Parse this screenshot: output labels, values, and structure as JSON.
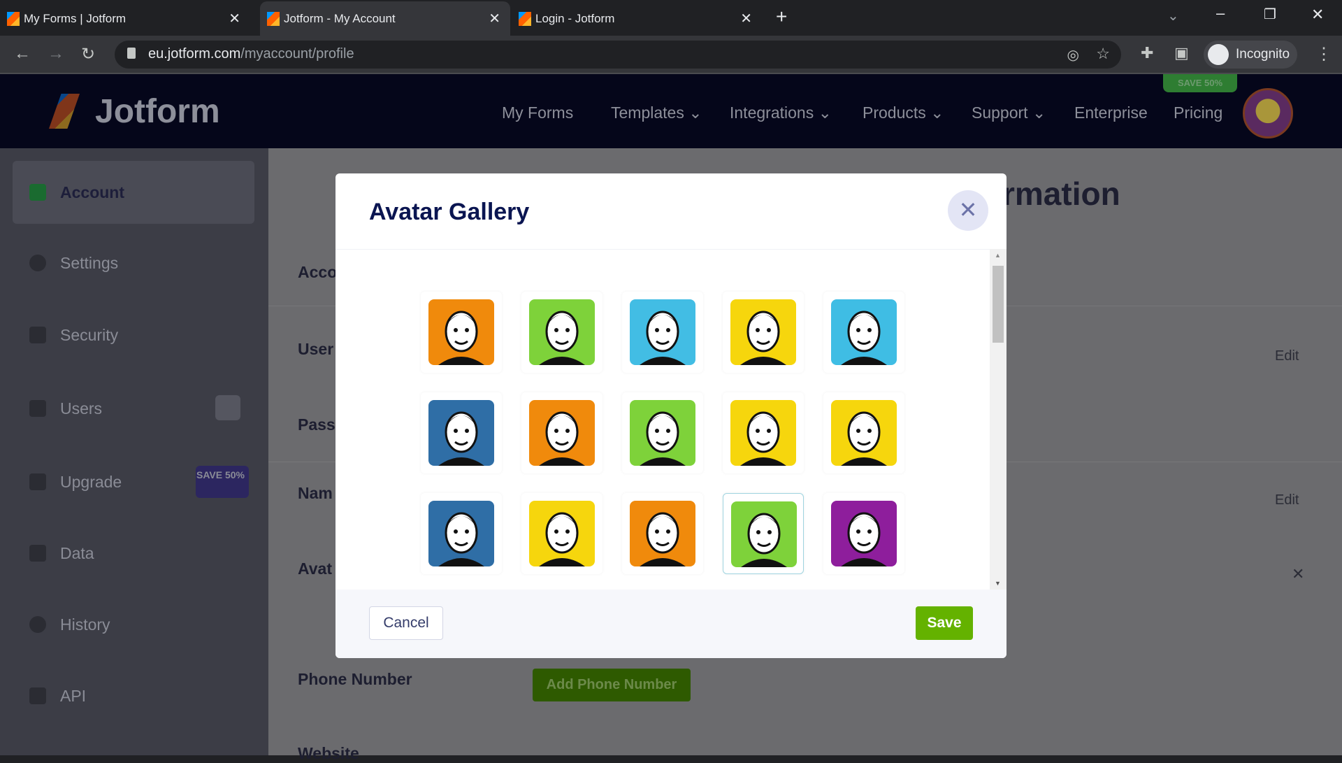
{
  "browser": {
    "tabs": [
      {
        "title": "My Forms | Jotform"
      },
      {
        "title": "Jotform - My Account"
      },
      {
        "title": "Login - Jotform"
      }
    ],
    "url_host": "eu.jotform.com",
    "url_path": "/myaccount/profile",
    "profile_label": "Incognito"
  },
  "header": {
    "logo": "Jotform",
    "menu": [
      "My Forms",
      "Templates",
      "Integrations",
      "Products",
      "Support",
      "Enterprise",
      "Pricing"
    ],
    "save_badge": "SAVE 50%"
  },
  "sidebar": {
    "items": [
      {
        "label": "Account",
        "icon": "user-icon"
      },
      {
        "label": "Settings",
        "icon": "gear-icon"
      },
      {
        "label": "Security",
        "icon": "lock-icon"
      },
      {
        "label": "Users",
        "icon": "users-icon"
      },
      {
        "label": "Upgrade",
        "icon": "upgrade-icon"
      },
      {
        "label": "Data",
        "icon": "database-icon"
      },
      {
        "label": "History",
        "icon": "history-icon"
      },
      {
        "label": "API",
        "icon": "api-icon"
      }
    ],
    "upgrade_badge": "SAVE 50%"
  },
  "main": {
    "title_fragment": "rmation",
    "labels": [
      "Acco",
      "User",
      "Pass",
      "Nam",
      "Avat"
    ],
    "phone_label": "Phone Number",
    "website_label": "Website",
    "edit": "Edit",
    "add_phone": "Add Phone Number"
  },
  "modal": {
    "title": "Avatar Gallery",
    "cancel": "Cancel",
    "save": "Save",
    "avatars": [
      "#f08a0c",
      "#7ed23a",
      "#42bde4",
      "#f6d60d",
      "#3fbde4",
      "#2f6ea6",
      "#f08a0c",
      "#7ed23a",
      "#f6d60d",
      "#f6d60d",
      "#2f6ea6",
      "#f6d60d",
      "#f08a0c",
      "#7ed23a",
      "#8e1e9c"
    ],
    "selected_index": 13
  },
  "colors": {
    "accent_green": "#64b200",
    "navy": "#0a1551"
  }
}
